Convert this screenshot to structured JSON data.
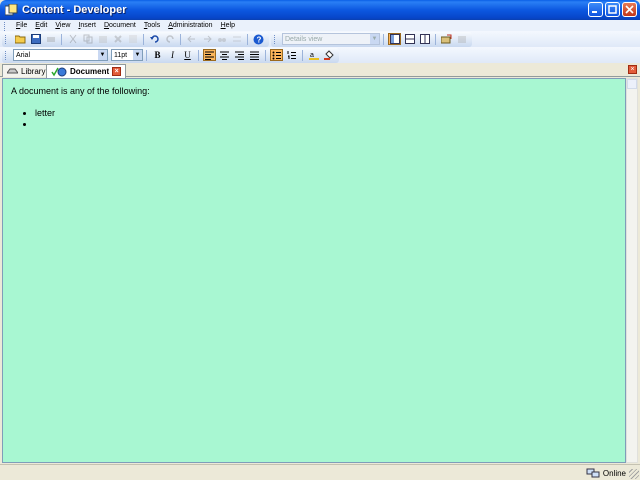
{
  "window": {
    "title": "Content - Developer"
  },
  "menu": {
    "items": [
      "File",
      "Edit",
      "View",
      "Insert",
      "Document",
      "Tools",
      "Administration",
      "Help"
    ]
  },
  "toolbar": {
    "view_select": "Details view"
  },
  "format": {
    "font": "Arial",
    "size": "11pt",
    "bold_label": "B",
    "italic_label": "I",
    "underline_label": "U"
  },
  "tabs": [
    {
      "label": "Library",
      "icon": "library-icon",
      "active": false
    },
    {
      "label": "Document",
      "icon": "document-check-icon",
      "active": true
    }
  ],
  "document": {
    "intro": "A document is any of the following:",
    "bullets": [
      "letter",
      ""
    ]
  },
  "status": {
    "connection": "Online"
  },
  "colors": {
    "editor_bg": "#a8f7d2",
    "titlebar": "#0a5fe6",
    "active_button": "#fcb65b"
  }
}
